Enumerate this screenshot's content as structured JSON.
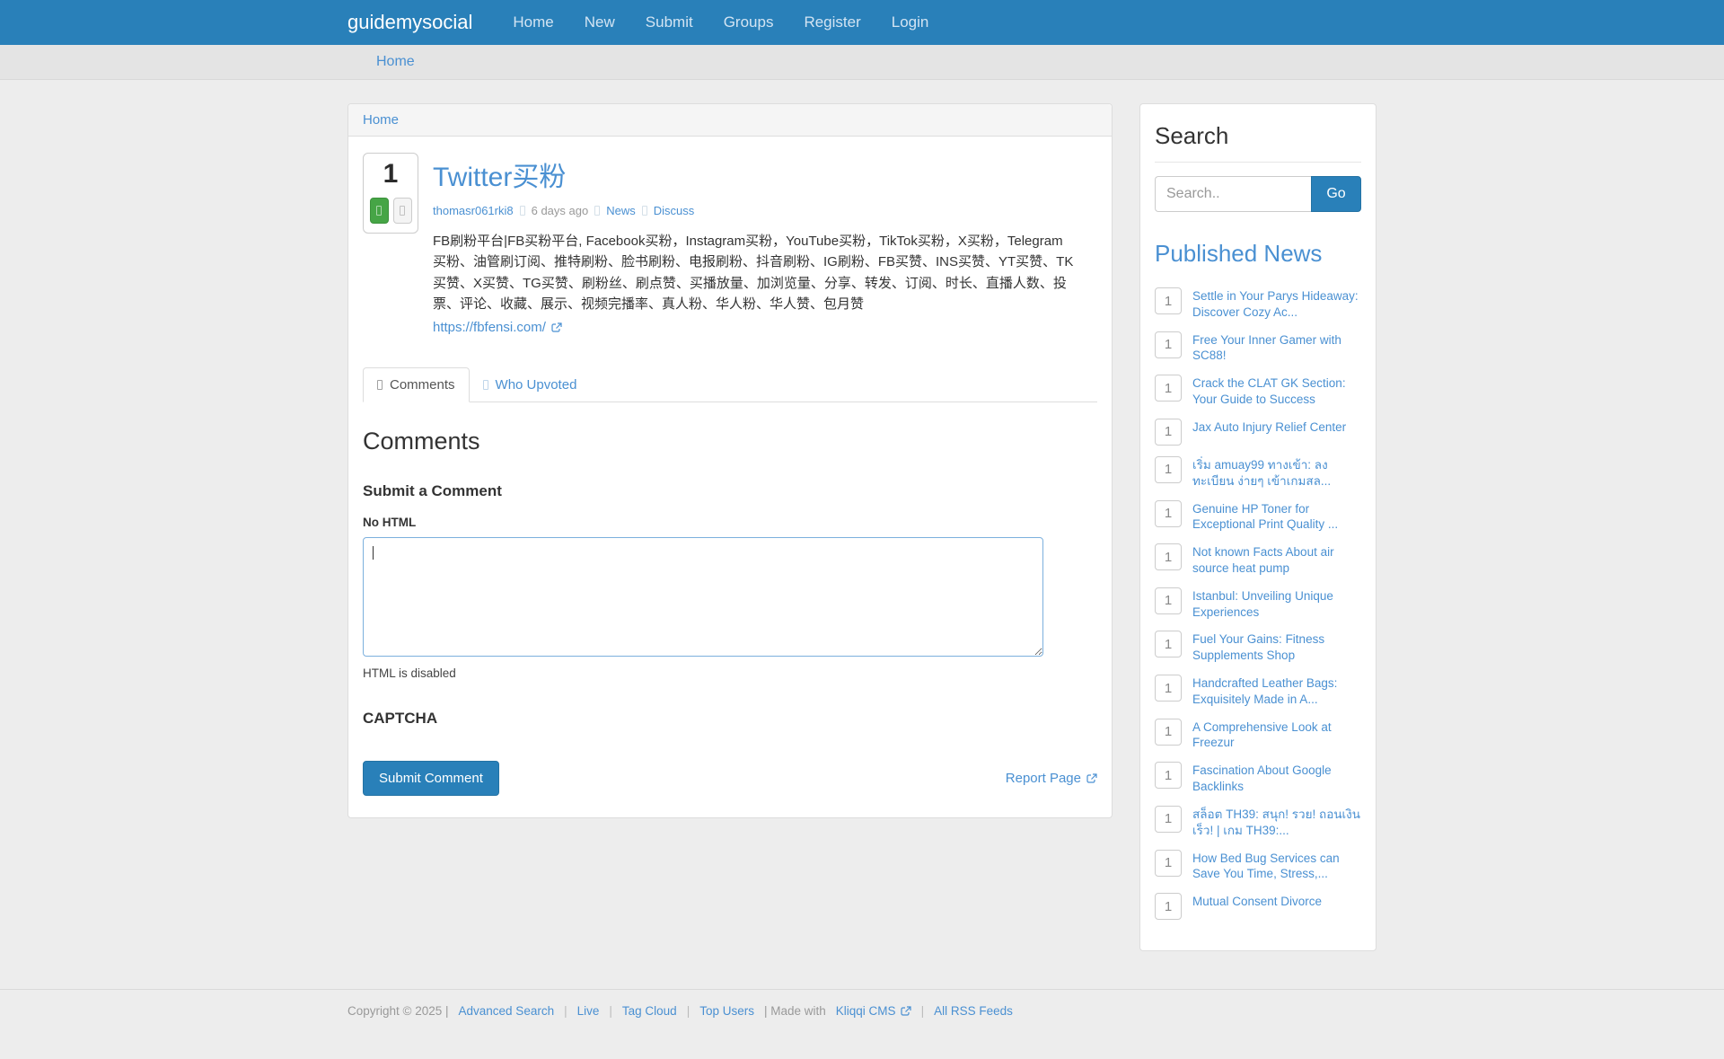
{
  "brand": "guidemysocial",
  "nav": {
    "items": [
      "Home",
      "New",
      "Submit",
      "Groups",
      "Register",
      "Login"
    ]
  },
  "breadcrumb_bar": {
    "home": "Home"
  },
  "card_header": {
    "home": "Home"
  },
  "post": {
    "votes": "1",
    "title": "Twitter买粉",
    "author": "thomasr061rki8",
    "time": "6 days ago",
    "category": "News",
    "discuss": "Discuss",
    "description": "FB刷粉平台|FB买粉平台, Facebook买粉，Instagram买粉，YouTube买粉，TikTok买粉，X买粉，Telegram买粉、油管刷订阅、推特刷粉、脸书刷粉、电报刷粉、抖音刷粉、IG刷粉、FB买赞、INS买赞、YT买赞、TK买赞、X买赞、TG买赞、刷粉丝、刷点赞、买播放量、加浏览量、分享、转发、订阅、时长、直播人数、投票、评论、收藏、展示、视频完播率、真人粉、华人粉、华人赞、包月赞",
    "link": "https://fbfensi.com/"
  },
  "tabs": {
    "comments": "Comments",
    "who_upvoted": "Who Upvoted"
  },
  "comments": {
    "heading": "Comments",
    "submit_heading": "Submit a Comment",
    "no_html": "No HTML",
    "textarea_value": "",
    "html_disabled": "HTML is disabled",
    "captcha": "CAPTCHA",
    "submit_button": "Submit Comment",
    "report_page": "Report Page"
  },
  "sidebar": {
    "search_heading": "Search",
    "search_placeholder": "Search..",
    "go_button": "Go",
    "published_heading": "Published News",
    "news": [
      {
        "count": "1",
        "title": "Settle in Your Parys Hideaway: Discover Cozy Ac..."
      },
      {
        "count": "1",
        "title": "Free Your Inner Gamer with SC88!"
      },
      {
        "count": "1",
        "title": "Crack the CLAT GK Section: Your Guide to Success"
      },
      {
        "count": "1",
        "title": "Jax Auto Injury Relief Center"
      },
      {
        "count": "1",
        "title": "เริ่ม amuay99 ทางเข้า: ลงทะเบียน ง่ายๆ เข้าเกมสล..."
      },
      {
        "count": "1",
        "title": "Genuine HP Toner for Exceptional Print Quality ..."
      },
      {
        "count": "1",
        "title": "Not known Facts About air source heat pump"
      },
      {
        "count": "1",
        "title": "Istanbul: Unveiling Unique Experiences"
      },
      {
        "count": "1",
        "title": "Fuel Your Gains: Fitness Supplements Shop"
      },
      {
        "count": "1",
        "title": "Handcrafted Leather Bags: Exquisitely Made in A..."
      },
      {
        "count": "1",
        "title": "A Comprehensive Look at Freezur"
      },
      {
        "count": "1",
        "title": "Fascination About Google Backlinks"
      },
      {
        "count": "1",
        "title": "สล็อต TH39: สนุก! รวย! ถอนเงินเร็ว! | เกม TH39:..."
      },
      {
        "count": "1",
        "title": "How Bed Bug Services can Save You Time, Stress,..."
      },
      {
        "count": "1",
        "title": "Mutual Consent Divorce"
      }
    ]
  },
  "footer": {
    "copyright": "Copyright © 2025 |",
    "links": [
      "Advanced Search",
      "Live",
      "Tag Cloud",
      "Top Users"
    ],
    "sep": "|",
    "made_with": "| Made with",
    "cms": "Kliqqi CMS",
    "rss": "All RSS Feeds"
  },
  "colors": {
    "navbar": "#2980b9",
    "link": "#4a90d2",
    "vote_up_green": "#46a546",
    "button_blue": "#2980b9",
    "page_bg": "#ededed"
  }
}
